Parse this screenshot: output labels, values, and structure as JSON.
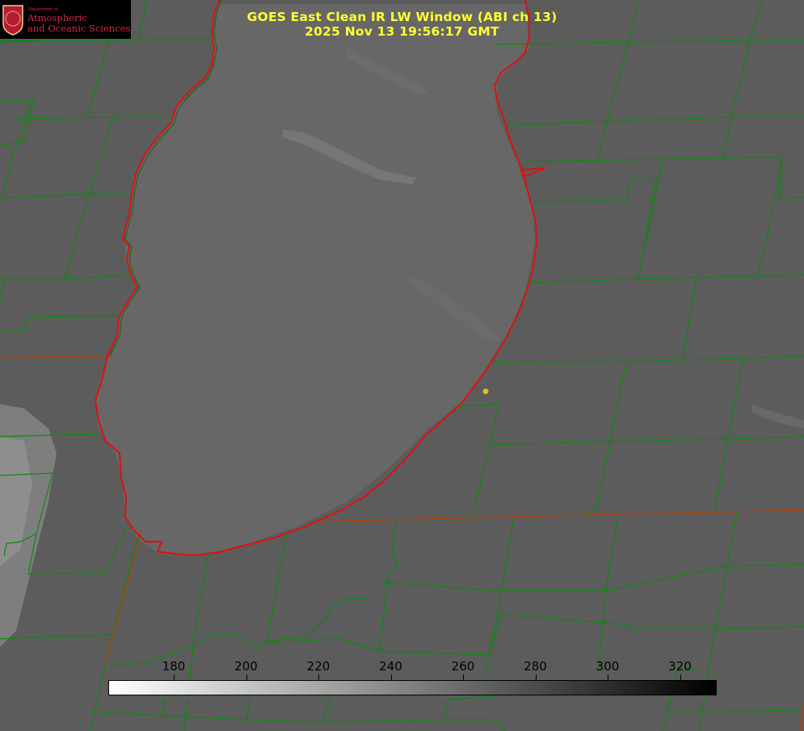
{
  "title": {
    "line1": "GOES East Clean IR LW Window (ABI ch 13)",
    "line2": "2025 Nov 13 19:56:17 GMT"
  },
  "logo": {
    "small_text": "Department of",
    "line1": "Atmospheric",
    "line2": "and Oceanic Sciences",
    "seal_letter": "W"
  },
  "colorbar": {
    "ticks": [
      "180",
      "200",
      "220",
      "240",
      "260",
      "280",
      "300",
      "320"
    ],
    "gradient": [
      "#ffffff",
      "#000000"
    ]
  },
  "colors": {
    "background": "#5c5c5c",
    "lake": "#666666",
    "county_lines": "#0b8a0b",
    "state_lines": "#b0400a",
    "shoreline": "#e01010",
    "title": "#ffff33",
    "logo_text": "#d4294a",
    "marker": "#d9c21a"
  }
}
